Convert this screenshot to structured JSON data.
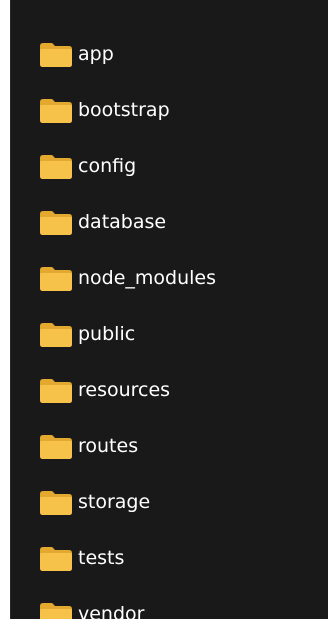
{
  "explorer": {
    "folders": [
      {
        "label": "app",
        "icon": "folder-icon"
      },
      {
        "label": "bootstrap",
        "icon": "folder-icon"
      },
      {
        "label": "config",
        "icon": "folder-icon"
      },
      {
        "label": "database",
        "icon": "folder-icon"
      },
      {
        "label": "node_modules",
        "icon": "folder-icon"
      },
      {
        "label": "public",
        "icon": "folder-icon"
      },
      {
        "label": "resources",
        "icon": "folder-icon"
      },
      {
        "label": "routes",
        "icon": "folder-icon"
      },
      {
        "label": "storage",
        "icon": "folder-icon"
      },
      {
        "label": "tests",
        "icon": "folder-icon"
      },
      {
        "label": "vendor",
        "icon": "folder-icon"
      }
    ]
  },
  "colors": {
    "background": "#191919",
    "folder": "#f6c24a",
    "folder_dark": "#e3a92f",
    "text": "#ffffff"
  }
}
